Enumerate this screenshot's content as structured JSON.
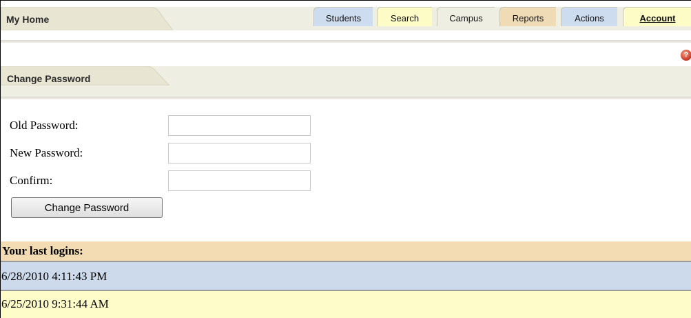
{
  "header": {
    "title": "My Home",
    "tabs": [
      {
        "label": "Students",
        "color": "#cddcee",
        "active": false
      },
      {
        "label": "Search",
        "color": "#fdfbc6",
        "active": false
      },
      {
        "label": "Campus",
        "color": "#efeee2",
        "active": false
      },
      {
        "label": "Reports",
        "color": "#efdcb7",
        "active": false
      },
      {
        "label": "Actions",
        "color": "#cddcee",
        "active": false
      },
      {
        "label": "Account",
        "color": "#fdfbc6",
        "active": true
      }
    ]
  },
  "help": {
    "icon": "help-icon",
    "glyph": "?"
  },
  "change_password": {
    "title": "Change Password",
    "old_label": "Old Password:",
    "new_label": "New Password:",
    "confirm_label": "Confirm:",
    "old_value": "",
    "new_value": "",
    "confirm_value": "",
    "button_label": "Change Password"
  },
  "logins": {
    "title": "Your last logins:",
    "entries": [
      "6/28/2010 4:11:43 PM",
      "6/25/2010 9:31:44 AM"
    ]
  }
}
